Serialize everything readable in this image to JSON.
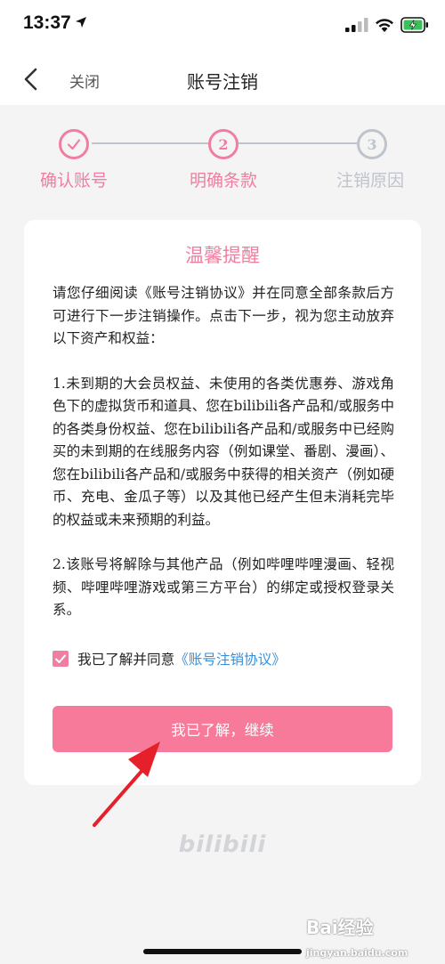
{
  "status_bar": {
    "time": "13:37",
    "icons": [
      "location-arrow-icon",
      "signal-icon",
      "wifi-icon",
      "battery-charging-icon"
    ]
  },
  "nav": {
    "back_icon": "chevron-left-icon",
    "close_label": "关闭",
    "title": "账号注销"
  },
  "steps": [
    {
      "number": "",
      "label": "确认账号",
      "state": "done"
    },
    {
      "number": "2",
      "label": "明确条款",
      "state": "current"
    },
    {
      "number": "3",
      "label": "注销原因",
      "state": "pending"
    }
  ],
  "card": {
    "title": "温馨提醒",
    "intro": "请您仔细阅读《账号注销协议》并在同意全部条款后方可进行下一步注销操作。点击下一步，视为您主动放弃以下资产和权益：",
    "item1": "1.未到期的大会员权益、未使用的各类优惠券、游戏角色下的虚拟货币和道具、您在bilibili各产品和/或服务中的各类身份权益、您在bilibili各产品和/或服务中已经购买的未到期的在线服务内容（例如课堂、番剧、漫画）、您在bilibili各产品和/或服务中获得的相关资产（例如硬币、充电、金瓜子等）以及其他已经产生但未消耗完毕的权益或未来预期的利益。",
    "item2": "2.该账号将解除与其他产品（例如哔哩哔哩漫画、轻视频、哔哩哔哩游戏或第三方平台）的绑定或授权登录关系。",
    "agree_text": "我已了解并同意",
    "agree_link": "《账号注销协议》",
    "agree_checked": true,
    "continue_label": "我已了解，继续"
  },
  "footer_logo": "bilibili",
  "watermark": {
    "main": "Bai",
    "accent": "经验",
    "small": "jingyan.baidu.com"
  },
  "colors": {
    "accent_pink": "#f07ea0",
    "button_pink": "#f77a9b",
    "link_blue": "#3a8fd9",
    "pending_gray": "#bfc3cc",
    "background": "#f4f4f5"
  }
}
